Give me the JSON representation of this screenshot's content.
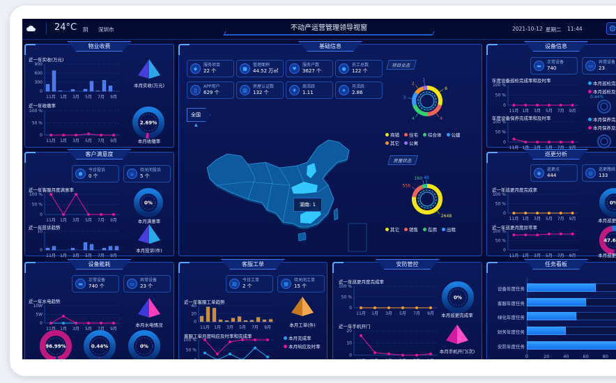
{
  "header": {
    "weather_icon": "cloud-icon",
    "temperature": "24°C",
    "weather": "阴",
    "city": "深圳市",
    "title": "不动产运营管理领导视窗",
    "date": "2021-10-12",
    "weekday": "星期二",
    "time": "11:44",
    "settings_icon": "gear-icon"
  },
  "colors": {
    "background": "#050d36",
    "panel_border": "#1d4cb8",
    "accent": "#3b7cff",
    "pink": "#e0179a",
    "orange": "#f0a030",
    "bar_blue": "#1e90ff"
  },
  "property_fee": {
    "title": "物业收费",
    "chart1": {
      "title": "近一年实收(万元)",
      "type": "bar",
      "ylim": [
        0,
        900
      ],
      "ytick_labels": [
        "0",
        "300",
        "600",
        "900"
      ],
      "xticks": [
        "11月",
        "1月",
        "3月",
        "5月",
        "7月",
        "9月"
      ],
      "values": [
        230,
        680,
        15,
        0,
        60,
        0,
        70,
        330,
        10,
        360,
        180,
        0
      ],
      "color": "#4a7dff"
    },
    "pyramid_label": "本月实收(万元)",
    "chart2": {
      "title": "近一年收缴率",
      "type": "line",
      "ylim": [
        0,
        100
      ],
      "ytick_labels": [
        "0",
        "50 %",
        "100 %"
      ],
      "xticks": [
        "11月",
        "1月",
        "3月",
        "5月",
        "7月",
        "9月"
      ],
      "series": [
        {
          "values": [
            0,
            0,
            0,
            5,
            0,
            0
          ],
          "color": "#e0179a"
        }
      ]
    },
    "gauge": {
      "value": "2.69%",
      "percent": 2.69,
      "label": "本月收缴率",
      "color": "#e0179a"
    }
  },
  "basic": {
    "title": "基础信息",
    "cards": [
      {
        "label": "服务项目",
        "value": "22 个",
        "icon": "layers-icon"
      },
      {
        "label": "管理面积",
        "value": "44.52 万㎡",
        "icon": "area-icon"
      },
      {
        "label": "服务户数",
        "value": "3627 个",
        "icon": "heart-icon"
      },
      {
        "label": "员工总数",
        "value": "122 个",
        "icon": "user-icon"
      },
      {
        "label": "APP用户",
        "value": "629 个",
        "icon": "phone-icon"
      },
      {
        "label": "房屋认证数",
        "value": "132 个",
        "icon": "building-icon"
      },
      {
        "label": "周活跃",
        "value": "1.11",
        "icon": "fire-icon"
      },
      {
        "label": "月活跃",
        "value": "2.86",
        "icon": "star-icon"
      }
    ],
    "map_button": "全国",
    "map_tooltip": "湖南: 1",
    "project_format": {
      "tag": "项目业态",
      "segments": [
        {
          "name": "商铺",
          "value": 6,
          "color": "#f5e50f"
        },
        {
          "name": "住宅",
          "value": 4,
          "color": "#f0645a"
        },
        {
          "name": "综合体",
          "value": 4,
          "color": "#2fd070"
        },
        {
          "name": "公建",
          "value": 3,
          "color": "#3399ff"
        },
        {
          "name": "其它",
          "value": 2,
          "color": "#f7931e"
        },
        {
          "name": "公寓",
          "value": 1,
          "color": "#9b6bf0"
        }
      ]
    },
    "house_status": {
      "tag": "房屋状态",
      "segments": [
        {
          "name": "其它",
          "value": 2648,
          "color": "#f5e50f"
        },
        {
          "name": "销售",
          "value": 556,
          "color": "#f0645a"
        },
        {
          "name": "在用",
          "value": 160,
          "color": "#2fd070"
        },
        {
          "name": "出租",
          "value": 40,
          "color": "#3399ff"
        }
      ]
    }
  },
  "device": {
    "title": "设备信息",
    "cards": [
      {
        "label": "正常设备",
        "value": "740",
        "icon": "device-icon"
      },
      {
        "label": "异常设备",
        "value": "23",
        "icon": "monitor-icon"
      }
    ],
    "chart1": {
      "title": "年度设备巡检完成率和及时率",
      "type": "line",
      "ylim": [
        0,
        100
      ],
      "ytick_labels": [
        "0",
        "50 %",
        "100 %"
      ],
      "xticks": [
        "11月",
        "1月",
        "3月",
        "5月",
        "7月",
        "9月"
      ],
      "series": [
        {
          "values": [
            0,
            0,
            0,
            0,
            0,
            0
          ],
          "color": "#e0179a"
        }
      ]
    },
    "legend1": [
      {
        "name": "本月巡检完成率",
        "color": "#1eaaf0"
      },
      {
        "name": "本月巡检及时率",
        "color": "#e0179a"
      }
    ],
    "pie_label": "0.44%",
    "chart2": {
      "title": "年度设备保养完成率和及时率",
      "type": "line",
      "ylim": [
        0,
        100
      ],
      "ytick_labels": [
        "0",
        "50 %",
        "100 %"
      ],
      "xticks": [
        "11月",
        "1月",
        "3月",
        "5月",
        "7月",
        "9月"
      ],
      "series": [
        {
          "values": [
            15,
            0,
            0,
            0,
            0,
            0
          ],
          "color": "#e0179a"
        }
      ]
    },
    "legend2": [
      {
        "name": "本月保养完成率",
        "color": "#1eaaf0"
      },
      {
        "name": "本月保养及时率",
        "color": "#e0179a"
      }
    ]
  },
  "customer": {
    "title": "客户满意度",
    "cards": [
      {
        "label": "今日投诉",
        "value": "0 个",
        "icon": "shield-icon"
      },
      {
        "label": "待关闭投诉",
        "value": "5 个",
        "icon": "house-icon"
      }
    ],
    "chart1": {
      "title": "近一年客服月度满意率",
      "type": "line",
      "ylim": [
        0,
        100
      ],
      "ytick_labels": [
        "0",
        "50 %",
        "100 %"
      ],
      "xticks": [
        "11月",
        "1月",
        "3月",
        "5月",
        "7月",
        "9月"
      ],
      "series": [
        {
          "values": [
            100,
            0,
            100,
            0,
            0,
            0
          ],
          "color": "#e0179a"
        }
      ]
    },
    "gauge": {
      "value": "0%",
      "percent": 0,
      "label": "本月满意率",
      "color": "#e0179a"
    },
    "chart2": {
      "title": "近一年投诉趋势",
      "type": "bar",
      "ylim": [
        0,
        10
      ],
      "ytick_labels": [
        "0",
        "10"
      ],
      "xticks": [
        "11月",
        "1月",
        "3月",
        "5月",
        "7月",
        "9月"
      ],
      "values": [
        1,
        2,
        0,
        0,
        1,
        0,
        4,
        3,
        0,
        1,
        2,
        2
      ],
      "color": "#4a7dff"
    },
    "pyramid_label": "本月投诉(件)"
  },
  "patrol": {
    "title": "巡更分析",
    "cards": [
      {
        "label": "巡更点",
        "value": "444",
        "icon": "location-icon"
      },
      {
        "label": "巡更路线",
        "value": "133",
        "icon": "route-icon"
      }
    ],
    "chart1": {
      "title": "近一年巡更月度完成率",
      "type": "line",
      "ylim": [
        0,
        100
      ],
      "ytick_labels": [
        "0",
        "50 %",
        "100 %"
      ],
      "xticks": [
        "11月",
        "1月",
        "3月",
        "5月",
        "7月",
        "9月"
      ],
      "series": [
        {
          "values": [
            0,
            0,
            0,
            0,
            0,
            0
          ],
          "color": "#f0a030"
        }
      ]
    },
    "gauge1": {
      "value": "0%",
      "percent": 0,
      "label": "本月巡更完成率",
      "color": "#e0179a"
    },
    "chart2": {
      "title": "近一年巡更月度异常率",
      "type": "line",
      "ylim": [
        0,
        100
      ],
      "ytick_labels": [
        "0",
        "50 %",
        "100 %"
      ],
      "xticks": [
        "11月",
        "1月",
        "3月",
        "5月",
        "7月",
        "9月"
      ],
      "series": [
        {
          "values": [
            80,
            80,
            80,
            85,
            85,
            85
          ],
          "color": "#e0179a"
        }
      ]
    },
    "gauge2": {
      "value": "47.69%",
      "percent": 47.69,
      "label": "本月巡更异常率",
      "color": "#c0187e"
    }
  },
  "energy": {
    "title": "设备能耗",
    "cards": [
      {
        "label": "正常设备",
        "value": "740 个",
        "icon": "device-icon"
      },
      {
        "label": "异常设备",
        "value": "23 个",
        "icon": "monitor-icon"
      }
    ],
    "chart1": {
      "title": "近一年水电趋势",
      "type": "line",
      "ylim": [
        0,
        10
      ],
      "ytick_labels": [
        "0",
        "5W",
        "10W"
      ],
      "xticks": [
        "11月",
        "1月",
        "3月",
        "5月",
        "7月",
        "9月"
      ],
      "series": [
        {
          "values": [
            0,
            0,
            0,
            0,
            0,
            0
          ],
          "color": "#1eaaf0"
        },
        {
          "values": [
            0,
            4,
            0,
            0,
            0,
            0
          ],
          "color": "#e0179a"
        }
      ]
    },
    "pyramid_label": "本月水电情况",
    "gauges": [
      {
        "value": "96.99%",
        "percent": 96.99,
        "color": "#c0187e"
      },
      {
        "value": "0.44%",
        "percent": 0.44,
        "color": "#e0179a"
      },
      {
        "value": "0%",
        "percent": 0,
        "color": "#e0179a"
      }
    ]
  },
  "workorder": {
    "title": "客服工单",
    "cards": [
      {
        "label": "今日工单",
        "value": "2 个",
        "icon": "document-icon"
      },
      {
        "label": "待关闭工单",
        "value": "15 个",
        "icon": "clipboard-icon"
      }
    ],
    "chart1": {
      "title": "近一年客服工单趋势",
      "type": "bar",
      "ylim": [
        0,
        40
      ],
      "ytick_labels": [
        "0",
        "20",
        "40"
      ],
      "xticks": [
        "11月",
        "1月",
        "3月",
        "5月",
        "7月",
        "9月"
      ],
      "values": [
        14,
        37,
        34,
        5,
        3,
        9,
        13,
        3,
        4,
        11,
        5,
        6
      ],
      "color": "#e0902a"
    },
    "pyramid_label": "本月工单(件)",
    "chart2": {
      "title": "客服工单月度响应及时率和完成率",
      "type": "line",
      "ylim": [
        0,
        100
      ],
      "ytick_labels": [
        "0",
        "50 %",
        "100 %"
      ],
      "xticks": [
        "11月",
        "1月",
        "3月",
        "5月",
        "7月",
        "9月"
      ],
      "series": [
        {
          "values": [
            100,
            30,
            90,
            100,
            100,
            100
          ],
          "color": "#e0179a"
        },
        {
          "values": [
            35,
            0,
            30,
            0,
            60,
            15
          ],
          "color": "#1eaaf0"
        }
      ]
    },
    "legend": [
      {
        "name": "本月完成率",
        "color": "#1eaaf0"
      },
      {
        "name": "本月响应及时率",
        "color": "#e0179a"
      }
    ]
  },
  "security": {
    "title": "安防管控",
    "chart1": {
      "title": "近一年巡更月度完成率",
      "type": "line",
      "ylim": [
        0,
        100
      ],
      "ytick_labels": [
        "0",
        "50 %",
        "100 %"
      ],
      "xticks": [
        "11月",
        "1月",
        "3月",
        "5月",
        "7月",
        "9月"
      ],
      "series": [
        {
          "values": [
            0,
            0,
            0,
            0,
            0,
            0
          ],
          "color": "#f0a030"
        }
      ]
    },
    "gauge": {
      "value": "0%",
      "percent": 0,
      "label": "本月巡更完成率",
      "color": "#e0179a"
    },
    "chart2": {
      "title": "近一年手机开门",
      "type": "line",
      "ylim": [
        0,
        20
      ],
      "ytick_labels": [
        "0",
        "10",
        "20"
      ],
      "xticks": [
        "11月",
        "1月",
        "3月",
        "5月",
        "7月",
        "9月"
      ],
      "series": [
        {
          "values": [
            16,
            2,
            1,
            0,
            0,
            1
          ],
          "color": "#e0179a"
        }
      ]
    },
    "pyramid_label": "本月手机开门(次)"
  },
  "tasks": {
    "title": "任务看板",
    "items": [
      {
        "label": "设备年度任务",
        "value": 70
      },
      {
        "label": "客服年度任务",
        "value": 60
      },
      {
        "label": "绿化年度任务",
        "value": 50
      },
      {
        "label": "财务年度任务",
        "value": 40
      },
      {
        "label": "安防年度任务",
        "value": 100
      }
    ],
    "xticks": [
      "0",
      "20",
      "40",
      "60",
      "80"
    ],
    "xlim": [
      0,
      100
    ]
  }
}
